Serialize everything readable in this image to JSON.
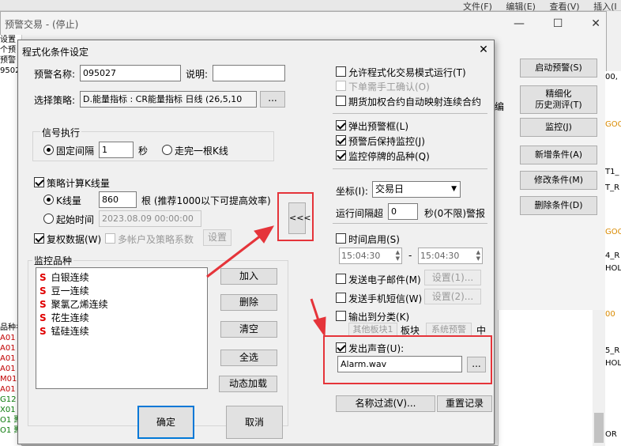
{
  "background": {
    "menu": [
      "文件(F)",
      "编辑(E)",
      "查看(V)",
      "插入(I"
    ],
    "window_title": "预警交易 - (停止)",
    "left_strip": [
      "设置",
      "个预",
      "预警",
      "9502",
      "",
      "",
      "",
      "",
      "",
      "",
      "",
      "",
      "",
      "",
      "",
      "",
      "",
      "",
      "",
      "",
      "",
      "",
      "",
      "",
      "",
      "",
      "",
      "",
      "品种名",
      "A01",
      "A01",
      "A01",
      "A01",
      "M01",
      "A01",
      "G12",
      "X01",
      "O1 聚",
      "O1 聚"
    ],
    "right_buttons": [
      "启动预警(S)",
      "精细化\n历史测评(T)",
      "监控(J)",
      "新增条件(A)",
      "修改条件(M)",
      "删除条件(D)"
    ],
    "right_text": [
      "00,",
      "GOO",
      "T1_",
      "T_R",
      "GOO",
      "4_R",
      "HOL",
      "00",
      "5_R",
      "HOL",
      "OR"
    ],
    "column_header": "编"
  },
  "dialog": {
    "title": "程式化条件设定",
    "name_label": "预警名称:",
    "name_value": "095027",
    "desc_label": "说明:",
    "desc_value": "",
    "strategy_label": "选择策略:",
    "strategy_value": "D.能量指标 : CR能量指标 日线 (26,5,10",
    "strategy_browse": "...",
    "signal_group": "信号执行",
    "fixed_interval_label": "固定间隔",
    "fixed_interval_value": "1",
    "sec_label": "秒",
    "bar_end_label": "走完一根K线",
    "strategy_calc_label": "策略计算K线量",
    "kline_count_label": "K线量",
    "kline_count_value": "860",
    "kline_hint": "根 (推荐1000以下可提高效率)",
    "start_time_label": "起始时间",
    "start_time_value": "2023.08.09 00:00:00",
    "rights_label": "复权数据(W)",
    "multi_account_label": "多帐户及策略系数",
    "settings_btn": "设置",
    "monitor_group": "监控品种",
    "monitor_items": [
      "白银连续",
      "豆一连续",
      "聚氯乙烯连续",
      "花生连续",
      "锰硅连续"
    ],
    "s_mark": "S",
    "add_btn": "加入",
    "delete_btn": "删除",
    "clear_btn": "清空",
    "select_all_btn": "全选",
    "dynamic_load_btn": "动态加载",
    "ok_btn": "确定",
    "cancel_btn": "取消",
    "collapse_btn": "<<<",
    "allow_mode_label": "允许程式化交易模式运行(T)",
    "manual_confirm_label": "下单需手工确认(O)",
    "futures_map_label": "期货加权合约自动映射连续合约",
    "popup_label": "弹出预警框(L)",
    "keep_monitor_label": "预警后保持监控(J)",
    "monitor_halted_label": "监控停牌的品种(Q)",
    "axis_label": "坐标(I):",
    "axis_value": "交易日",
    "interval_label": "运行间隔超",
    "interval_value": "0",
    "interval_suffix": "秒(0不限)警报",
    "time_enable_label": "时间启用(S)",
    "time_from": "15:04:30",
    "time_dash": "-",
    "time_to": "15:04:30",
    "email_label": "发送电子邮件(M)",
    "email_settings": "设置(1)...",
    "sms_label": "发送手机短信(W)",
    "sms_settings": "设置(2)...",
    "output_category_label": "输出到分类(K)",
    "other_board_btn": "其他板块1",
    "board_label": "板块",
    "system_alert_btn": "系统预警",
    "middle_label": "中",
    "sound_label": "发出声音(U):",
    "sound_value": "Alarm.wav",
    "sound_browse": "...",
    "name_filter_btn": "名称过滤(V)...",
    "reset_record_btn": "重置记录"
  },
  "colors": {
    "highlight": "#e5343a",
    "s_mark": "#e00000"
  }
}
